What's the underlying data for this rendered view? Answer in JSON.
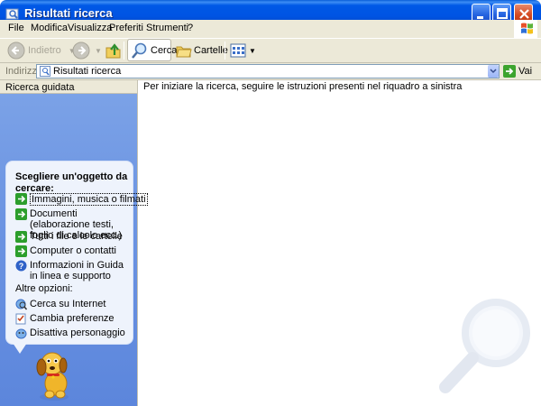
{
  "window": {
    "title": "Risultati ricerca"
  },
  "menu": [
    {
      "label": "File"
    },
    {
      "label": "Modifica"
    },
    {
      "label": "Visualizza"
    },
    {
      "label": "Preferiti"
    },
    {
      "label": "Strumenti"
    },
    {
      "label": "?"
    }
  ],
  "toolbar": {
    "back_label": "Indietro",
    "search_label": "Cerca",
    "folders_label": "Cartelle"
  },
  "address": {
    "label": "Indirizzo",
    "value": "Risultati ricerca",
    "go_label": "Vai"
  },
  "leftpane": {
    "header": "Ricerca guidata",
    "prompt_title": "Scegliere un'oggetto da cercare:",
    "options": [
      {
        "label": "Immagini, musica o filmati"
      },
      {
        "label": "Documenti (elaborazione testi, foglio di calcolo ecc.)"
      },
      {
        "label": "Tutti i file e le cartelle"
      },
      {
        "label": "Computer o contatti"
      },
      {
        "label": "Informazioni in Guida in linea e supporto"
      }
    ],
    "other_title": "Altre opzioni:",
    "other_options": [
      {
        "label": "Cerca su Internet"
      },
      {
        "label": "Cambia preferenze"
      },
      {
        "label": "Disattiva personaggio"
      }
    ]
  },
  "content": {
    "message": "Per iniziare la ricerca, seguire le istruzioni presenti nel riquadro a sinistra"
  }
}
